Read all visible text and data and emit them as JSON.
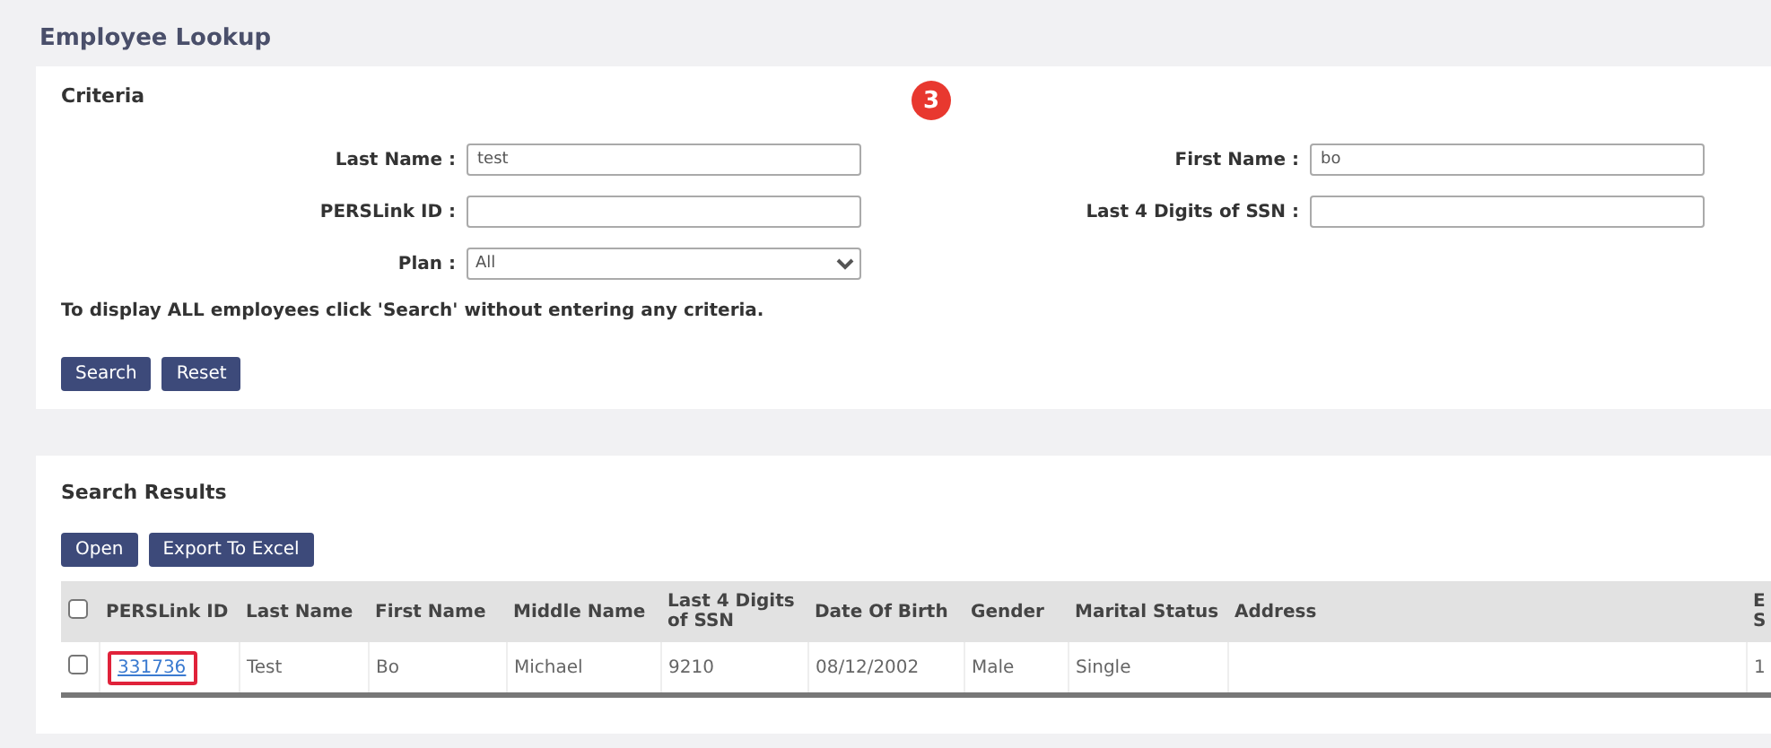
{
  "page_title": "Employee Lookup",
  "criteria": {
    "title": "Criteria",
    "step_badge": "3",
    "left_fields": [
      {
        "label": "Last Name :",
        "kind": "text",
        "value": "test"
      },
      {
        "label": "PERSLink ID :",
        "kind": "text"
      },
      {
        "label": "Plan :",
        "kind": "select",
        "value": "All"
      }
    ],
    "right_fields": [
      {
        "label": "First Name :",
        "kind": "text",
        "value": "bo"
      },
      {
        "label": "Last 4 Digits of SSN :",
        "kind": "text"
      }
    ],
    "hint": "To display ALL employees click 'Search' without entering any criteria.",
    "buttons": [
      "Search",
      "Reset"
    ]
  },
  "results": {
    "title": "Search Results",
    "buttons": [
      "Open",
      "Export To Excel"
    ],
    "columns": [
      "PERSLink ID",
      "Last Name",
      "First Name",
      "Middle Name",
      "Last 4 Digits of SSN",
      "Date Of Birth",
      "Gender",
      "Marital Status",
      "Address",
      "E S"
    ],
    "all_checked": false,
    "rows": [
      {
        "checked": false,
        "highlighted": true,
        "cells": [
          "331736",
          "Test",
          "Bo",
          "Michael",
          "9210",
          "08/12/2002",
          "Male",
          "Single",
          "",
          "1"
        ]
      }
    ]
  }
}
